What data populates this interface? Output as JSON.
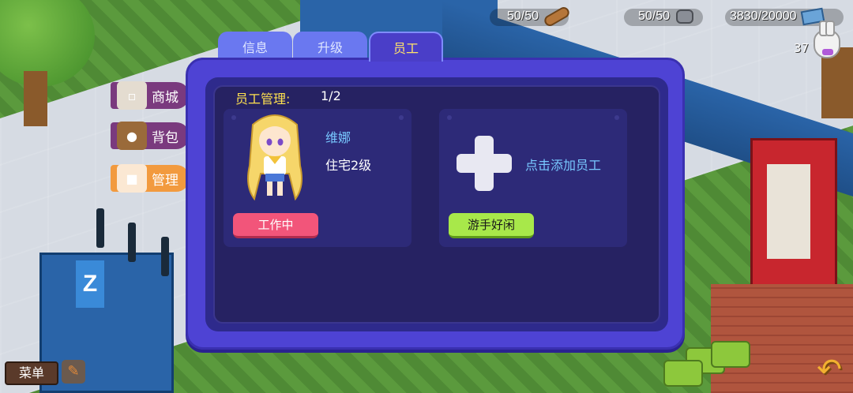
{
  "hud": {
    "wood": "50/50",
    "stone": "50/50",
    "money": "3830/20000",
    "level": "37"
  },
  "side_menu": {
    "shop": "商城",
    "bag": "背包",
    "manage": "管理"
  },
  "bottom": {
    "menu": "菜单"
  },
  "tabs": [
    "信息",
    "升级",
    "员工"
  ],
  "staff_panel": {
    "label": "员工管理:",
    "count": "1/2",
    "staff": {
      "name": "维娜",
      "home": "住宅2级",
      "status": "工作中"
    },
    "empty_slot": {
      "add_text": "点击添加员工",
      "status": "游手好闲"
    }
  },
  "colors": {
    "modal_bg": "#4e43d4",
    "panel_bg": "#262262",
    "active_tab_text": "#ffe36a",
    "label_yellow": "#ffe14f",
    "name_blue": "#78c8ff",
    "working_pink": "#f2557a",
    "idle_green": "#a8e84a",
    "manage_orange": "#f29a3e"
  },
  "icons": [
    "log-icon",
    "stone-icon",
    "cash-icon",
    "rabbit-icon",
    "shop-icon",
    "bag-icon",
    "manage-icon",
    "plus-icon",
    "tool-icon",
    "back-arrow-icon"
  ]
}
